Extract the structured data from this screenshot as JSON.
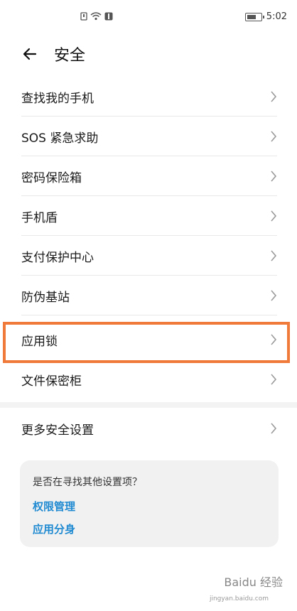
{
  "status": {
    "time": "5:02"
  },
  "header": {
    "title": "安全"
  },
  "items": [
    {
      "label": "查找我的手机"
    },
    {
      "label": "SOS 紧急求助"
    },
    {
      "label": "密码保险箱"
    },
    {
      "label": "手机盾"
    },
    {
      "label": "支付保护中心"
    },
    {
      "label": "防伪基站"
    },
    {
      "label": "应用锁"
    },
    {
      "label": "文件保密柜"
    }
  ],
  "more": {
    "label": "更多安全设置"
  },
  "suggest": {
    "question": "是否在寻找其他设置项？",
    "link1": "权限管理",
    "link2": "应用分身"
  },
  "watermark": {
    "text": "Baidu 经验",
    "sub": "jingyan.baidu.com"
  },
  "colors": {
    "highlight": "#f07a3a",
    "link": "#1f8ad1"
  }
}
